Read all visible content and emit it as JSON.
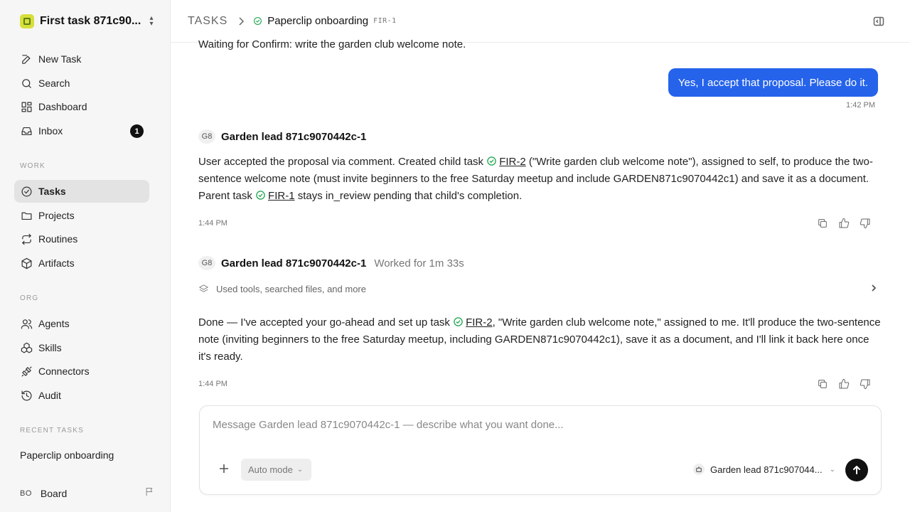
{
  "workspace": {
    "name": "First task 871c90..."
  },
  "sidebar": {
    "nav": [
      {
        "label": "New Task",
        "icon": "edit-icon"
      },
      {
        "label": "Search",
        "icon": "search-icon"
      },
      {
        "label": "Dashboard",
        "icon": "dashboard-icon"
      },
      {
        "label": "Inbox",
        "icon": "inbox-icon",
        "badge": "1"
      }
    ],
    "work_label": "WORK",
    "work": [
      {
        "label": "Tasks",
        "icon": "check-circle-icon",
        "active": true
      },
      {
        "label": "Projects",
        "icon": "folder-icon"
      },
      {
        "label": "Routines",
        "icon": "repeat-icon"
      },
      {
        "label": "Artifacts",
        "icon": "cube-icon"
      }
    ],
    "org_label": "ORG",
    "org": [
      {
        "label": "Agents",
        "icon": "users-icon"
      },
      {
        "label": "Skills",
        "icon": "boxes-icon"
      },
      {
        "label": "Connectors",
        "icon": "plug-icon"
      },
      {
        "label": "Audit",
        "icon": "history-icon"
      }
    ],
    "recent_label": "RECENT TASKS",
    "recent": [
      "Paperclip onboarding"
    ],
    "board": {
      "initials": "BO",
      "name": "Board"
    }
  },
  "header": {
    "root": "TASKS",
    "title": "Paperclip onboarding",
    "id": "FIR-1"
  },
  "thread": {
    "top_text": "Waiting for Confirm: write the garden club welcome note.",
    "user_message": "Yes, I accept that proposal. Please do it.",
    "user_time": "1:42 PM",
    "messages": [
      {
        "avatar": "G8",
        "author": "Garden lead 871c9070442c-1",
        "parts": {
          "a": "User accepted the proposal via comment. Created child task ",
          "link1": "FIR-2",
          "b": " (\"Write garden club welcome note\"), assigned to self, to produce the two-sentence welcome note (must invite beginners to the free Saturday meetup and include GARDEN871c9070442c1) and save it as a document. Parent task ",
          "link2": "FIR-1",
          "c": " stays in_review pending that child's completion."
        },
        "time": "1:44 PM"
      },
      {
        "avatar": "G8",
        "author": "Garden lead 871c9070442c-1",
        "worked": "Worked for 1m 33s",
        "tools": "Used tools, searched files, and more",
        "parts": {
          "a": "Done — I've accepted your go-ahead and set up task ",
          "link1": "FIR-2",
          "b": ", \"Write garden club welcome note,\" assigned to me. It'll produce the two-sentence note (inviting beginners to the free Saturday meetup, including GARDEN871c9070442c1), save it as a document, and I'll link it back here once it's ready."
        },
        "time": "1:44 PM"
      }
    ]
  },
  "composer": {
    "placeholder": "Message Garden lead 871c9070442c-1 — describe what you want done...",
    "mode": "Auto mode",
    "agent": "Garden lead 871c907044..."
  },
  "colors": {
    "accent": "#2563eb",
    "success": "#16a34a",
    "sidebar_bg": "#f6f6f6"
  }
}
